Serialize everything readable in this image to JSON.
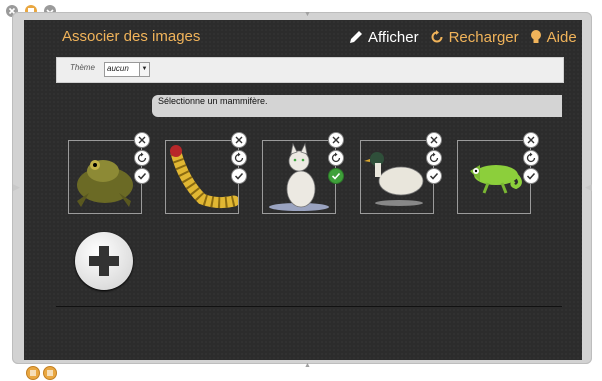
{
  "window": {
    "title": "Associer des images",
    "toolbar": {
      "show_label": "Afficher",
      "reload_label": "Recharger",
      "help_label": "Aide"
    }
  },
  "theme": {
    "label": "Thème",
    "selected": "aucun"
  },
  "instruction": "Sélectionne un mammifère.",
  "cards": [
    {
      "icon": "frog-image",
      "validated": false
    },
    {
      "icon": "caterpillar-image",
      "validated": false
    },
    {
      "icon": "cat-image",
      "validated": true
    },
    {
      "icon": "duck-image",
      "validated": false
    },
    {
      "icon": "chameleon-image",
      "validated": false
    }
  ],
  "colors": {
    "title": "#f0b35a",
    "panel": "#2c2c2c",
    "validated": "#3fa03a"
  }
}
